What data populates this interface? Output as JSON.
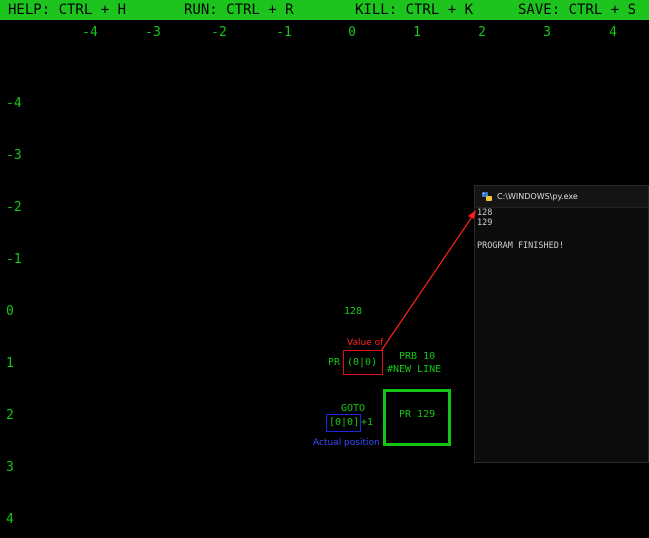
{
  "hotkey_bar": {
    "help": "HELP: CTRL + H",
    "run": "RUN: CTRL + R",
    "kill": "KILL: CTRL + K",
    "save": "SAVE: CTRL + S"
  },
  "grid": {
    "columns": [
      "-4",
      "-3",
      "-2",
      "-1",
      "0",
      "1",
      "2",
      "3",
      "4"
    ],
    "rows": [
      "-4",
      "-3",
      "-2",
      "-1",
      "0",
      "1",
      "2",
      "3",
      "4"
    ]
  },
  "cells": {
    "value_128": "128",
    "pr_prefix": "PR",
    "pr_ref": "(0|0)",
    "prb_line1": "PRB 10",
    "prb_line2": "#NEW LINE",
    "goto_label": "GOTO",
    "goto_ref": "[0|0]",
    "goto_suffix": "+1",
    "pr_129": "PR 129"
  },
  "annotations": {
    "value_of": "Value of",
    "actual_position": "Actual position",
    "red_color": "#ff2020",
    "blue_color": "#3a4cff"
  },
  "console": {
    "title": "C:\\WINDOWS\\py.exe",
    "icon": "python-console-icon",
    "output_lines": [
      "128",
      "129",
      "",
      "PROGRAM FINISHED!"
    ]
  },
  "colors": {
    "accent_green": "#15c515",
    "topbar_green": "#1ec41e",
    "background": "#000000"
  }
}
